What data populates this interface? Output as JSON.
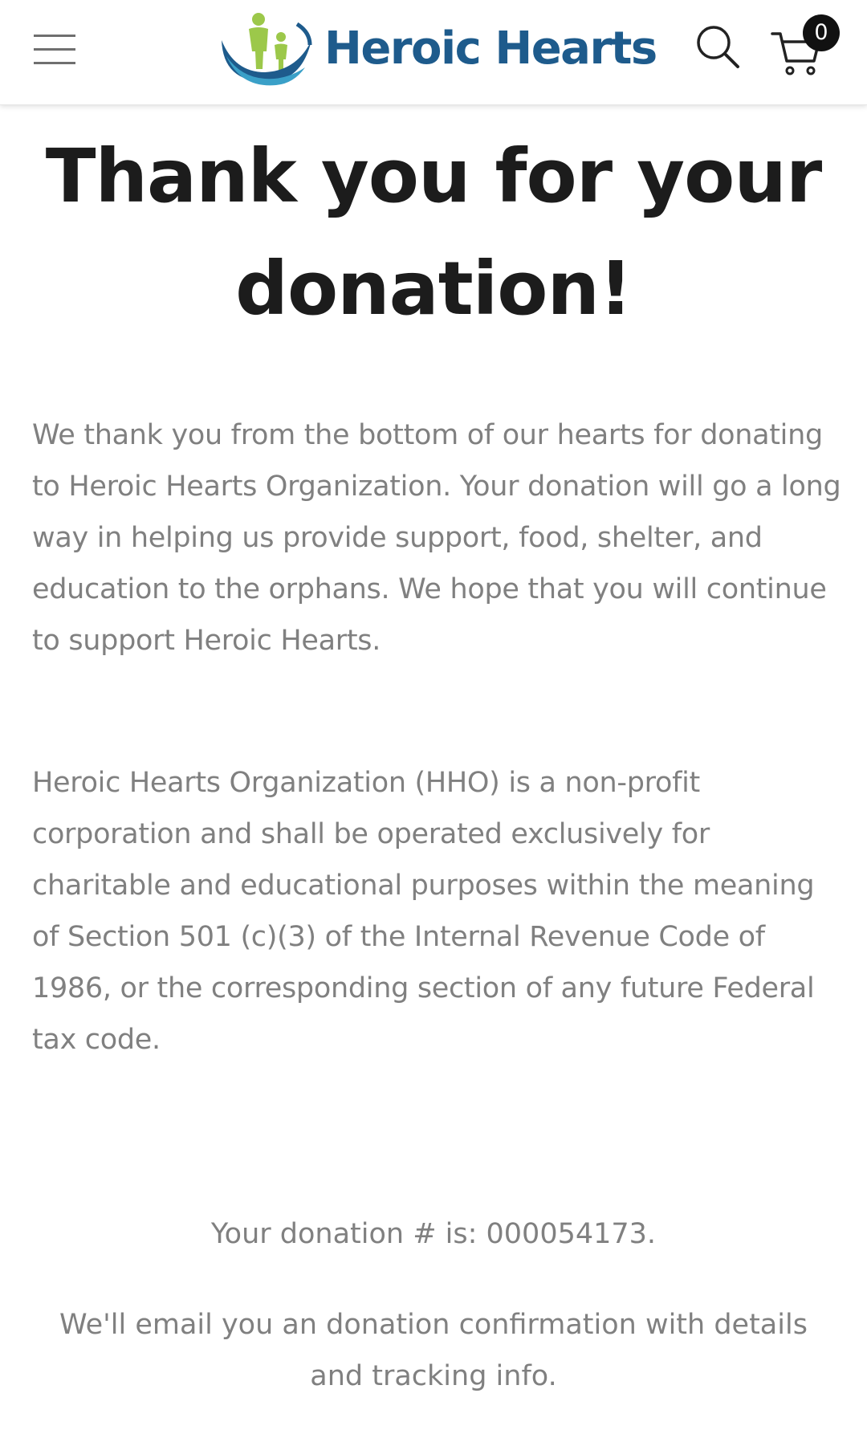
{
  "header": {
    "menu_icon": "hamburger-menu-icon",
    "logo": {
      "text": "Heroic Hearts",
      "mark_icon": "family-swoosh-logo-icon",
      "colors": {
        "figures": "#9cc84a",
        "swoosh": "#1e5b8c",
        "swoosh_light": "#3aa0c8",
        "text": "#1e5b8c"
      }
    },
    "search_icon": "search-icon",
    "cart": {
      "icon": "shopping-cart-icon",
      "count": "0"
    }
  },
  "main": {
    "title": "Thank you for your donation!",
    "paragraphs": [
      "We thank you from the bottom of our hearts for donating to Heroic Hearts Organization. Your donation will go a long way in helping us provide support, food, shelter, and education to the orphans. We hope that you will continue to support Heroic Hearts.",
      "Heroic Hearts Organization (HHO) is a non-profit corporation and shall be operated exclusively for charitable and educational purposes within the meaning of Section 501 (c)(3) of the Internal Revenue Code of 1986, or the corresponding section of any future Federal tax code."
    ],
    "donation_number": "Your donation # is: 000054173.",
    "email_note": "We'll email you an donation confirmation with details and tracking info."
  },
  "colors": {
    "title": "#1c1c1c",
    "body_text": "#808080",
    "badge": "#111111"
  }
}
